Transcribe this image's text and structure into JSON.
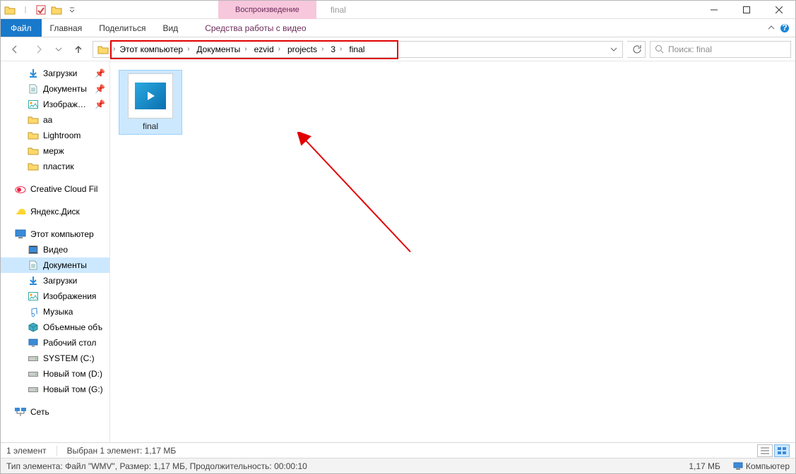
{
  "window": {
    "title": "final"
  },
  "context_tab": {
    "label": "Воспроизведение"
  },
  "ribbon": {
    "file": "Файл",
    "tabs": [
      "Главная",
      "Поделиться",
      "Вид"
    ],
    "context_tab": "Средства работы с видео"
  },
  "breadcrumb": {
    "segments": [
      "Этот компьютер",
      "Документы",
      "ezvid",
      "projects",
      "3",
      "final"
    ]
  },
  "search": {
    "placeholder": "Поиск: final"
  },
  "nav": {
    "quick": [
      {
        "label": "Загрузки",
        "icon": "download-icon",
        "pinned": true
      },
      {
        "label": "Документы",
        "icon": "document-icon",
        "pinned": true
      },
      {
        "label": "Изображени",
        "icon": "picture-icon",
        "pinned": true
      },
      {
        "label": "aa",
        "icon": "folder-icon",
        "pinned": false
      },
      {
        "label": "Lightroom",
        "icon": "folder-icon",
        "pinned": false
      },
      {
        "label": "мерж",
        "icon": "folder-icon",
        "pinned": false
      },
      {
        "label": "пластик",
        "icon": "folder-icon",
        "pinned": false
      }
    ],
    "creative": {
      "label": "Creative Cloud Fil",
      "icon": "creative-icon"
    },
    "yandex": {
      "label": "Яндекс.Диск",
      "icon": "yandex-icon"
    },
    "thispc": {
      "label": "Этот компьютер",
      "icon": "computer-icon"
    },
    "thispc_children": [
      {
        "label": "Видео",
        "icon": "video-icon",
        "selected": false
      },
      {
        "label": "Документы",
        "icon": "document-icon",
        "selected": true
      },
      {
        "label": "Загрузки",
        "icon": "download-icon",
        "selected": false
      },
      {
        "label": "Изображения",
        "icon": "picture-icon",
        "selected": false
      },
      {
        "label": "Музыка",
        "icon": "music-icon",
        "selected": false
      },
      {
        "label": "Объемные объ",
        "icon": "objects3d-icon",
        "selected": false
      },
      {
        "label": "Рабочий стол",
        "icon": "desktop-icon",
        "selected": false
      },
      {
        "label": "SYSTEM (C:)",
        "icon": "drive-icon",
        "selected": false
      },
      {
        "label": "Новый том (D:)",
        "icon": "drive-icon",
        "selected": false
      },
      {
        "label": "Новый том (G:)",
        "icon": "drive-icon",
        "selected": false
      }
    ],
    "network": {
      "label": "Сеть",
      "icon": "network-icon"
    }
  },
  "files": [
    {
      "name": "final"
    }
  ],
  "status": {
    "count": "1 элемент",
    "selection": "Выбран 1 элемент: 1,17 МБ"
  },
  "details": {
    "line": "Тип элемента: Файл \"WMV\", Размер: 1,17 МБ, Продолжительность: 00:00:10",
    "size": "1,17 МБ",
    "location": "Компьютер"
  }
}
